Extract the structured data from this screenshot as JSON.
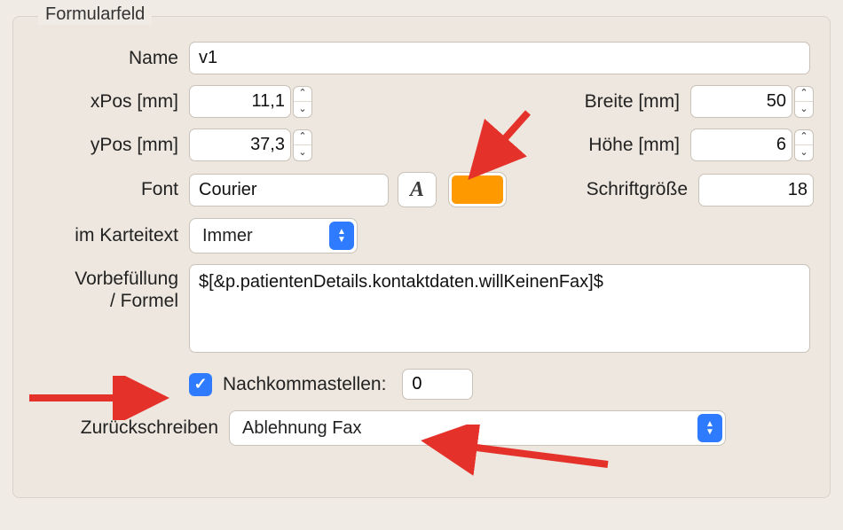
{
  "legend": "Formularfeld",
  "labels": {
    "name": "Name",
    "xpos": "xPos [mm]",
    "ypos": "yPos [mm]",
    "font": "Font",
    "breite": "Breite [mm]",
    "hoehe": "Höhe [mm]",
    "schriftgroesse": "Schriftgröße",
    "karteitext": "im Karteitext",
    "vorbefuellung_l1": "Vorbefüllung",
    "vorbefuellung_l2": "/ Formel",
    "nachkomma": "Nachkommastellen:",
    "zurueckschreiben": "Zurückschreiben"
  },
  "values": {
    "name": "v1",
    "xpos": "11,1",
    "ypos": "37,3",
    "breite": "50",
    "hoehe": "6",
    "font": "Courier",
    "schriftgroesse": "18",
    "karteitext": "Immer",
    "vorbefuellung": "$[&p.patientenDetails.kontaktdaten.willKeinenFax]$",
    "nachkomma_checked": true,
    "nachkomma": "0",
    "zurueckschreiben": "Ablehnung Fax"
  },
  "icons": {
    "font_button": "A"
  },
  "colors": {
    "swatch": "#ff9900"
  }
}
